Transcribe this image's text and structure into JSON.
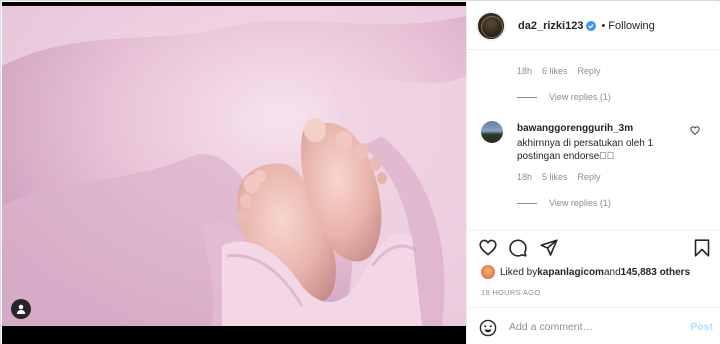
{
  "post": {
    "username": "da2_rizki123",
    "separator": "•",
    "follow_status": "Following"
  },
  "comments": [
    {
      "meta": {
        "time": "18h",
        "likes": "6 likes",
        "reply": "Reply"
      },
      "view_replies": "View replies (1)"
    },
    {
      "username": "bawanggorenggurih_3m",
      "text": "akhirnnya di persatukan oleh 1 postingan endorse\u0000\u0000",
      "meta": {
        "time": "18h",
        "likes": "5 likes",
        "reply": "Reply"
      },
      "view_replies": "View replies (1)"
    }
  ],
  "likes": {
    "prefix": "Liked by ",
    "user": "kapanlagicom",
    "and": " and ",
    "others": "145,883 others"
  },
  "timestamp": "18 HOURS AGO",
  "add_comment": {
    "placeholder": "Add a comment…",
    "post_label": "Post"
  },
  "colors": {
    "link_blue": "#b2dffc",
    "muted": "#8e8e8e",
    "verified": "#3897f0"
  },
  "icons": [
    "user-tag-icon",
    "verified-icon",
    "heart-icon",
    "comment-icon",
    "share-icon",
    "bookmark-icon",
    "emoji-icon"
  ]
}
